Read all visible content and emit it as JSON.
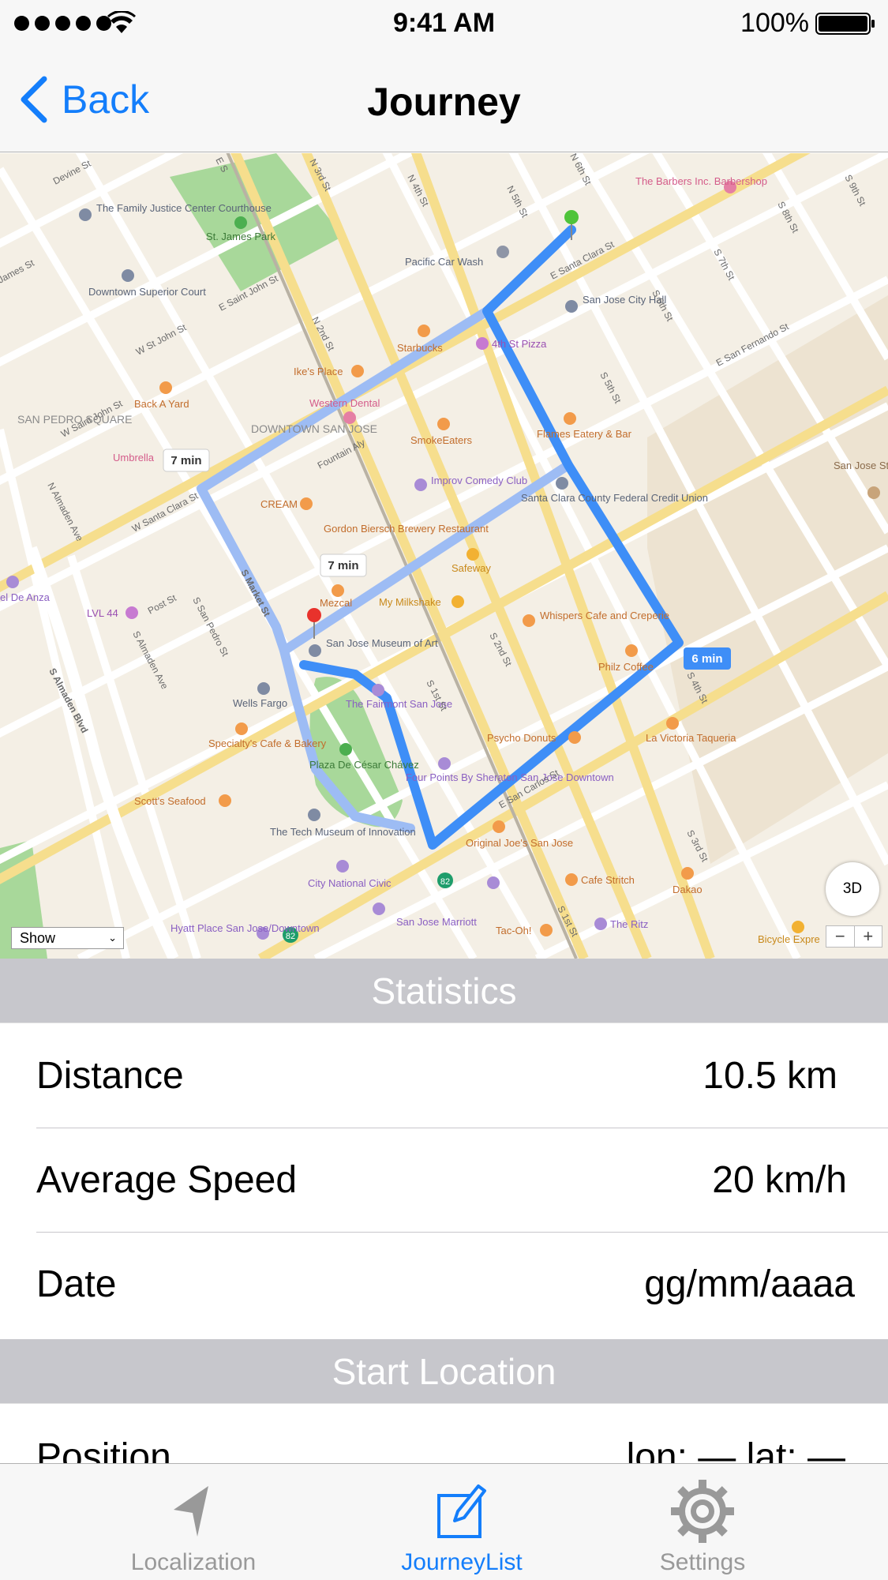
{
  "status_bar": {
    "time": "9:41 AM",
    "battery_percent": "100%"
  },
  "nav": {
    "back_label": "Back",
    "title": "Journey"
  },
  "map": {
    "labels": {
      "st_james_park": "St. James Park",
      "family_justice": "The Family Justice Center Courthouse",
      "superior_court": "Downtown Superior Court",
      "san_pedro": "SAN PEDRO SQUARE",
      "downtown": "DOWNTOWN SAN JOSE",
      "pacific_car_wash": "Pacific Car Wash",
      "starbucks": "Starbucks",
      "fourth_st_pizza": "4th St Pizza",
      "city_hall": "San Jose City Hall",
      "barbers": "The Barbers Inc. Barbershop",
      "ikes": "Ike's Place",
      "western_dental": "Western Dental",
      "back_a_yard": "Back A Yard",
      "smokeeaters": "SmokeEaters",
      "flames": "Flames Eatery & Bar",
      "umbrella": "Umbrella",
      "cream": "CREAM",
      "improv": "Improv Comedy Club",
      "credit_union": "Santa Clara County Federal Credit Union",
      "gordon_biersch": "Gordon Biersch Brewery Restaurant",
      "safeway": "Safeway",
      "mezcal": "Mezcal",
      "milkshake": "My Milkshake",
      "whispers": "Whispers Cafe and Creperie",
      "museum": "San Jose Museum of Art",
      "philz": "Philz Coffee",
      "lvl44": "LVL 44",
      "wells_fargo": "Wells Fargo",
      "fairmont": "The Fairmont San Jose",
      "specialtys": "Specialty's Cafe & Bakery",
      "psycho_donuts": "Psycho Donuts",
      "la_victoria": "La Victoria Taqueria",
      "plaza": "Plaza De César Chávez",
      "sheraton": "Four Points By Sheraton San Jose Downtown",
      "scotts": "Scott's Seafood",
      "tech_museum": "The Tech Museum of Innovation",
      "original_joes": "Original Joe's San Jose",
      "cafe_stritch": "Cafe Stritch",
      "dakao": "Dakao",
      "city_national": "City National Civic",
      "hyatt": "Hyatt Place San Jose/Downtown",
      "marriott": "San Jose Marriott",
      "tac_oh": "Tac-Oh!",
      "the_ritz": "The Ritz",
      "bicycle_express": "Bicycle Expre",
      "sjsu": "San Jose State Univers",
      "del_anza": "el De Anza",
      "hwy_82": "82"
    },
    "streets": {
      "santa_clara_e": "E Santa Clara St",
      "santa_clara_w": "W Santa Clara St",
      "san_fernando": "E San Fernando St",
      "san_carlos": "E San Carlos St",
      "market": "S Market St",
      "first_s": "S 1st St",
      "second_s": "S 2nd St",
      "fourth_s": "S 4th St",
      "n3rd": "N 3rd St",
      "n4th": "N 4th St",
      "n5th": "N 5th St",
      "n6th": "N 6th St",
      "s7th": "S 7th St",
      "s9th": "S 9th St",
      "s8th": "S 8th St",
      "s6th": "S 6th St",
      "s5th": "S 5th St",
      "s3rd": "S 3rd St",
      "s1st_lower": "S 1st St",
      "devine": "Devine St",
      "james": "James St",
      "st_john_w": "W St John St",
      "st_john_e": "E Saint John St",
      "st_john_w2": "W Saint John St",
      "fountain": "Fountain Aly",
      "n2nd": "N 2nd St",
      "almaden_blvd": "S Almaden Blvd",
      "almaden_ave_n": "N Almaden Ave",
      "almaden_ave_s": "S Almaden Ave",
      "post": "Post St",
      "san_pedro_st": "S San Pedro St",
      "e_st": "E S"
    },
    "route_times": {
      "route_a": "7 min",
      "route_b": "7 min",
      "route_c": "6 min"
    },
    "show_select": "Show",
    "button_3d": "3D",
    "zoom_out": "−",
    "zoom_in": "+"
  },
  "statistics": {
    "header": "Statistics",
    "distance_label": "Distance",
    "distance_value": "10.5 km",
    "speed_label": "Average Speed",
    "speed_value": "20 km/h",
    "date_label": "Date",
    "date_value": "gg/mm/aaaa"
  },
  "start_location": {
    "header": "Start Location",
    "position_label": "Position",
    "position_value": "lon: — lat: —"
  },
  "tab_bar": {
    "tabs": [
      {
        "label": "Localization"
      },
      {
        "label": "JourneyList"
      },
      {
        "label": "Settings"
      }
    ]
  },
  "colors": {
    "accent": "#147efb",
    "inactive": "#999999",
    "route": "#3e8ef7",
    "route_alt": "#9dbcf4",
    "section_header": "#c7c7cc"
  }
}
